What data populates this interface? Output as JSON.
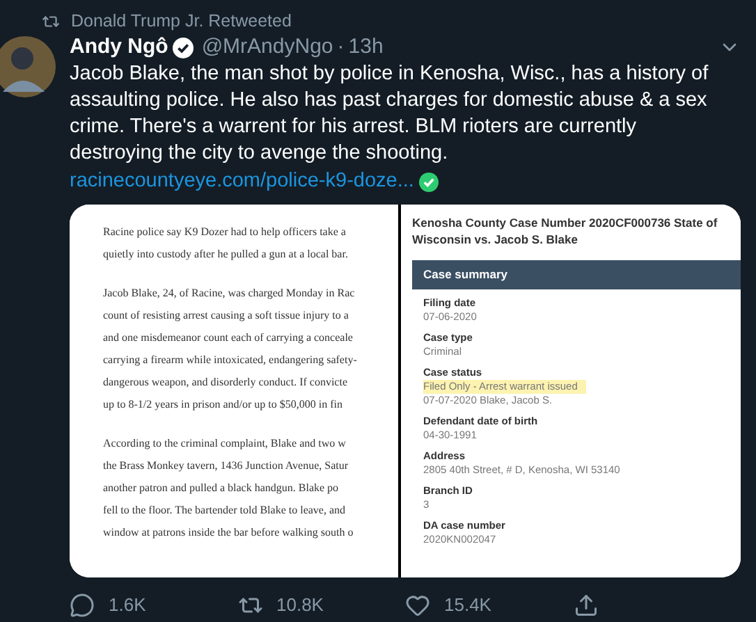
{
  "retweet_banner": "Donald Trump Jr. Retweeted",
  "tweet": {
    "author": "Andy Ngô",
    "verified": true,
    "handle": "@MrAndyNgo",
    "separator": "·",
    "time": "13h",
    "text": "Jacob Blake, the man shot by police in Kenosha, Wisc., has a history of assaulting police. He also has past charges for domestic abuse & a sex crime. There's a warrent for his arrest. BLM rioters are currently destroying the city to avenge the shooting.",
    "link": "racinecountyeye.com/police-k9-doze..."
  },
  "article": {
    "paragraphs": [
      {
        "lines": [
          "Racine police say K9 Dozer had to help officers take a",
          "quietly into custody after he pulled a gun at a local bar."
        ]
      },
      {
        "lines": [
          "Jacob Blake, 24, of Racine, was charged Monday in Rac",
          "count of resisting arrest causing a soft tissue injury to a",
          "and one misdemeanor count each of carrying a conceale",
          "carrying a firearm while intoxicated, endangering safety-",
          "dangerous weapon, and disorderly conduct. If convicte",
          "up to 8-1/2 years in prison and/or up to $50,000 in fin"
        ]
      },
      {
        "lines": [
          "According to the criminal complaint, Blake and two w",
          "the Brass Monkey tavern, 1436 Junction Avenue, Satur",
          "another patron and pulled a black handgun. Blake po",
          "fell to the floor. The bartender told Blake to leave, and",
          "window at patrons inside the bar before walking south o"
        ]
      }
    ]
  },
  "case_record": {
    "title": "Kenosha County Case Number 2020CF000736 State of Wisconsin vs. Jacob S. Blake",
    "header": "Case summary",
    "fields": [
      {
        "label": "Filing date",
        "value": "07-06-2020",
        "highlighted": false
      },
      {
        "label": "Case type",
        "value": "Criminal",
        "highlighted": false
      },
      {
        "label": "Case status",
        "value": "Filed Only - Arrest warrant issued",
        "detail": "07-07-2020 Blake, Jacob S.",
        "highlighted": true
      },
      {
        "label": "Defendant date of birth",
        "value": "04-30-1991",
        "highlighted": false
      },
      {
        "label": "Address",
        "value": "2805 40th Street, # D, Kenosha, WI 53140",
        "highlighted": false
      },
      {
        "label": "Branch ID",
        "value": "3",
        "highlighted": false
      },
      {
        "label": "DA case number",
        "value": "2020KN002047",
        "highlighted": false
      }
    ]
  },
  "actions": [
    {
      "kind": "reply",
      "count": "1.6K"
    },
    {
      "kind": "retweet",
      "count": "10.8K"
    },
    {
      "kind": "like",
      "count": "15.4K"
    },
    {
      "kind": "share"
    }
  ]
}
